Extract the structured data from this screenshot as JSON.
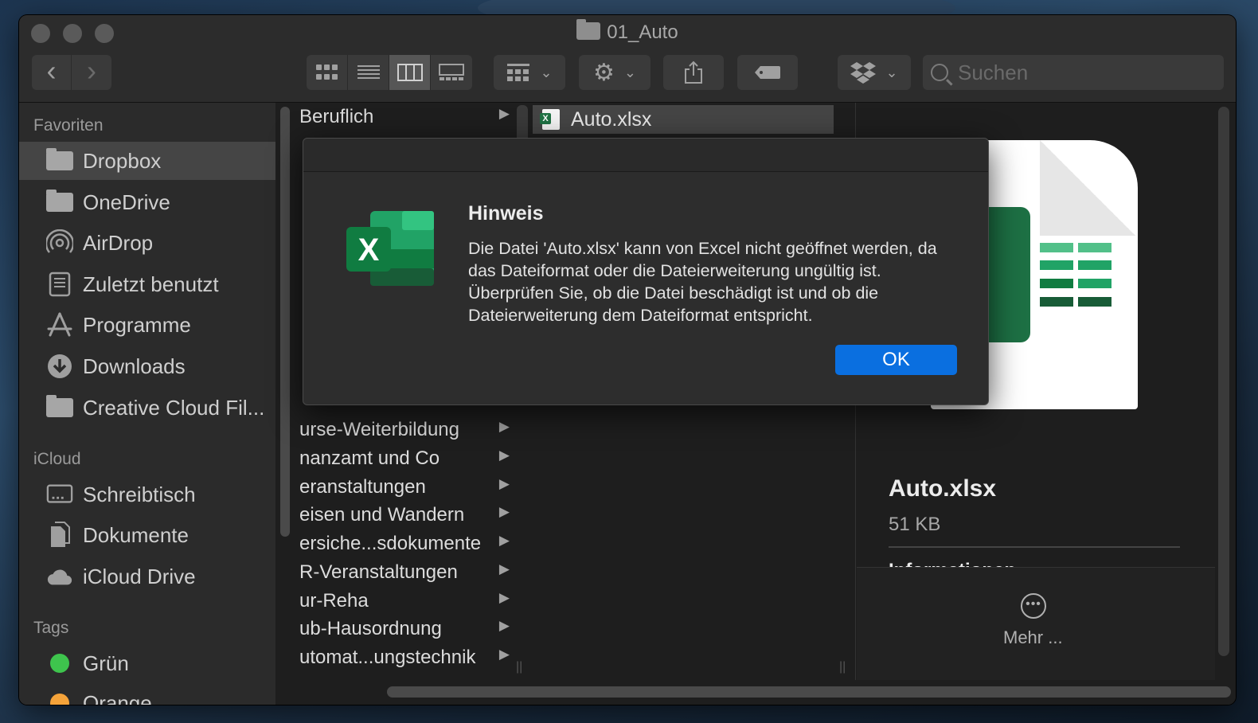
{
  "window": {
    "title": "01_Auto"
  },
  "toolbar": {
    "back_label": "‹",
    "forward_label": "›",
    "search_placeholder": "Suchen"
  },
  "sidebar": {
    "favorites_header": "Favoriten",
    "favorites": [
      {
        "label": "Dropbox",
        "icon": "folder-icon",
        "selected": true
      },
      {
        "label": "OneDrive",
        "icon": "folder-icon"
      },
      {
        "label": "AirDrop",
        "icon": "airdrop-icon"
      },
      {
        "label": "Zuletzt benutzt",
        "icon": "recents-icon"
      },
      {
        "label": "Programme",
        "icon": "applications-icon"
      },
      {
        "label": "Downloads",
        "icon": "download-icon"
      },
      {
        "label": "Creative Cloud Fil...",
        "icon": "folder-icon"
      }
    ],
    "icloud_header": "iCloud",
    "icloud": [
      {
        "label": "Schreibtisch",
        "icon": "desktop-icon"
      },
      {
        "label": "Dokumente",
        "icon": "documents-icon"
      },
      {
        "label": "iCloud Drive",
        "icon": "cloud-icon"
      }
    ],
    "tags_header": "Tags",
    "tags": [
      {
        "label": "Grün",
        "color": "#3ec44d"
      },
      {
        "label": "Orange",
        "color": "#f5a33a"
      }
    ]
  },
  "column1": {
    "rows": [
      "Beruflich",
      "urse-Weiterbildung",
      "nanzamt und Co",
      "eranstaltungen",
      "eisen und Wandern",
      "ersiche...sdokumente",
      "R-Veranstaltungen",
      "ur-Reha",
      "ub-Hausordnung",
      "utomat...ungstechnik"
    ]
  },
  "column2": {
    "selected_file": "Auto.xlsx"
  },
  "preview": {
    "file_name": "Auto.xlsx",
    "file_size": "51 KB",
    "info_header": "Informationen",
    "more_label": "Mehr ..."
  },
  "dialog": {
    "title": "Hinweis",
    "message": "Die Datei 'Auto.xlsx' kann von Excel nicht geöffnet werden, da das Dateiformat oder die Dateierweiterung ungültig ist. Überprüfen Sie, ob die Datei beschädigt ist und ob die Dateierweiterung dem Dateiformat entspricht.",
    "ok_label": "OK",
    "logo_letter": "X"
  },
  "colors": {
    "accent": "#0a6fe0",
    "excel_green": "#1d7044"
  }
}
